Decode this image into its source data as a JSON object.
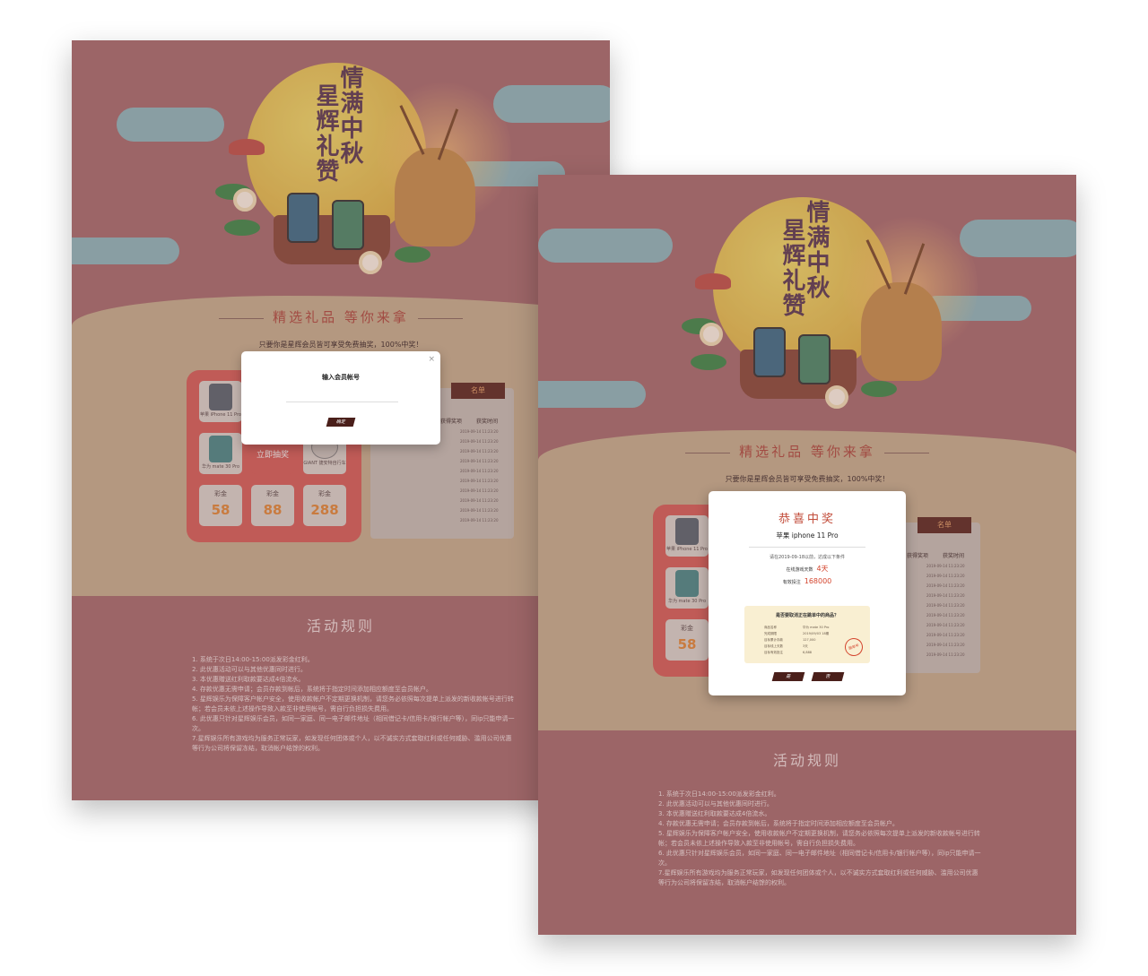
{
  "banner": {
    "title_line1": "情满中秋",
    "title_line2": "星辉礼赞"
  },
  "prizes": {
    "section_title": "精选礼品  等你来拿",
    "subtitle": "只要你是星辉会员皆可享受免费抽奖，100%中奖！",
    "items": [
      {
        "label": "苹果 iPhone 11 Pro"
      },
      {
        "label": "华为 mate 30 Pro"
      },
      {
        "label": "GIANT 捷安特自行车"
      }
    ],
    "draw_button": "立即抽奖",
    "money_label": "彩金",
    "money_values": [
      "58",
      "88",
      "288"
    ]
  },
  "winners": {
    "ribbon": "名单",
    "col_prize": "获得奖项",
    "col_time": "获奖时间",
    "rows": [
      {
        "user": "",
        "prize": "",
        "time": "2019-09-14 11:23:20"
      },
      {
        "user": "",
        "prize": "",
        "time": "2019-09-14 11:23:20"
      },
      {
        "user": "",
        "prize": "",
        "time": "2019-09-14 11:23:20"
      },
      {
        "user": "",
        "prize": "",
        "time": "2019-09-14 11:23:20"
      },
      {
        "user": "",
        "prize": "",
        "time": "2019-09-14 11:23:20"
      },
      {
        "user": "",
        "prize": "",
        "time": "2019-09-14 11:23:20"
      },
      {
        "user": "",
        "prize": "",
        "time": "2019-09-14 11:23:20"
      },
      {
        "user": "",
        "prize": "",
        "time": "2019-09-14 11:23:20"
      },
      {
        "user": "",
        "prize": "",
        "time": "2019-09-14 11:23:20"
      },
      {
        "user": "",
        "prize": "",
        "time": "2019-09-14 11:23:20"
      }
    ]
  },
  "rules": {
    "title": "活动规则",
    "items": [
      "1. 系统于次日14:00-15:00派发彩金红利。",
      "2. 此优惠活动可以与其他优惠同时进行。",
      "3. 本优惠赠送红利取款要达成4倍流水。",
      "4. 存款优惠无需申请；会员存款到帐后，系统将于指定时间添加相应额度至会员帐户。",
      "5. 星辉娱乐为保障客户帐户安全，使用收款帐户不定期更换机制，请您务必依照每次提单上派发的新收款帐号进行转帐；若会员未依上述操作导致入款至非使用帐号，需自行负担损失费用。",
      "6. 此优惠只针对星辉娱乐会员，如同一家庭、同一电子邮件地址（相同借记卡/信用卡/银行帐户等），同ip只能申请一次。",
      "7.星辉娱乐所有游戏均为服务正常玩家，如发现任何团体或个人，以不诚实方式套取红利或任何威胁、滥用公司优惠等行为公司将保留冻结，取消帐户结馀的权利。"
    ]
  },
  "login_modal": {
    "title": "输入会员帐号",
    "confirm": "确定"
  },
  "win_modal": {
    "title": "恭喜中奖",
    "prize": "苹果 iphone 11 Pro",
    "note": "请在2019-09-18以前，达成以下条件",
    "online_days_label": "在线游戏天数",
    "online_days_value": "4天",
    "valid_bet_label": "有效投注",
    "valid_bet_value": "168000",
    "confirm_question": "是否要取消正在跳单中的商品？",
    "details": [
      {
        "k": "商品名称",
        "v": "华为 mate 30 Pro"
      },
      {
        "k": "完成期限",
        "v": "2019/09/03 18期"
      },
      {
        "k": "目标累计存款",
        "v": "127,000"
      },
      {
        "k": "目标线上天数",
        "v": "3天"
      },
      {
        "k": "目标有效投注",
        "v": "6,888"
      }
    ],
    "stamp": "跳单中",
    "yes": "是",
    "no": "否"
  },
  "colors": {
    "page_bg": "#a96c6f",
    "beige": "#c9b190",
    "accent_red": "#d85f5a",
    "dark_button": "#4a1f1a"
  }
}
